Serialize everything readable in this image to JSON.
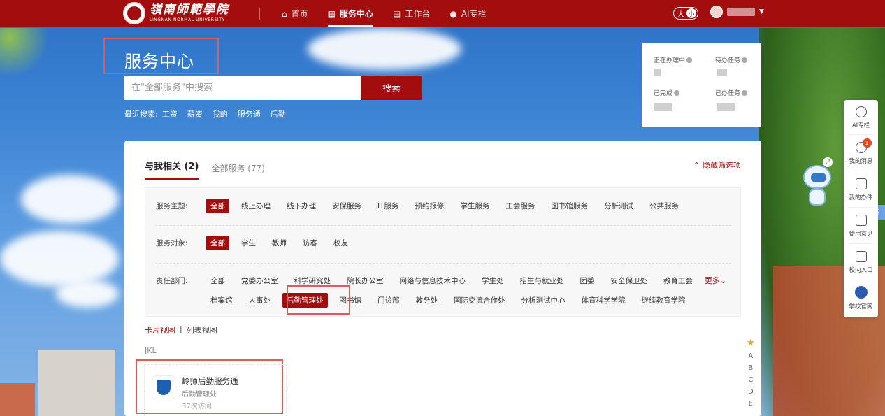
{
  "header": {
    "logo_cn": "嶺南師範學院",
    "logo_en": "LINGNAN NORMAL UNIVERSITY",
    "nav": [
      {
        "label": "首页",
        "icon": "home-icon"
      },
      {
        "label": "服务中心",
        "icon": "service-icon",
        "active": true
      },
      {
        "label": "工作台",
        "icon": "desk-icon"
      },
      {
        "label": "AI专栏",
        "icon": "ai-icon"
      }
    ],
    "font_toggle_large": "大",
    "font_toggle_small": "小"
  },
  "hero": {
    "title": "服务中心",
    "search_placeholder": "在\"全部服务\"中搜索",
    "search_button": "搜索",
    "recent_label": "最近搜索:",
    "recent_terms": [
      "工资",
      "薪资",
      "我的",
      "服务通",
      "后勤"
    ]
  },
  "stats": {
    "in_progress": "正在办理中",
    "todo": "待办任务",
    "done": "已完成",
    "handled": "已办任务"
  },
  "tabs": {
    "mine": "与我相关 (2)",
    "all": "全部服务 (77)",
    "hide_filter": "隐藏筛选项"
  },
  "filters": {
    "theme_label": "服务主题:",
    "theme_chips": [
      "全部",
      "线上办理",
      "线下办理",
      "安保服务",
      "IT服务",
      "预约报修",
      "学生服务",
      "工会服务",
      "图书馆服务",
      "分析测试",
      "公共服务"
    ],
    "target_label": "服务对象:",
    "target_chips": [
      "全部",
      "学生",
      "教师",
      "访客",
      "校友"
    ],
    "dept_label": "责任部门:",
    "dept_chips_row1": [
      "全部",
      "党委办公室",
      "科学研究处",
      "院长办公室",
      "网络与信息技术中心",
      "学生处",
      "招生与就业处",
      "团委",
      "安全保卫处",
      "教育工会"
    ],
    "dept_chips_row2": [
      "档案馆",
      "人事处",
      "后勤管理处",
      "图书馆",
      "门诊部",
      "教务处",
      "国际交流合作处",
      "分析测试中心",
      "体育科学学院",
      "继续教育学院"
    ],
    "more": "更多"
  },
  "view": {
    "card": "卡片视图",
    "sep": "|",
    "list": "列表视图"
  },
  "group_letter": "JKL",
  "service": {
    "name": "岭师后勤服务通",
    "dept": "后勤管理处",
    "visits": "37次访问"
  },
  "alpha_index": [
    "A",
    "B",
    "C",
    "D",
    "E"
  ],
  "float_bar": [
    {
      "label": "AI专栏",
      "icon": "ai-assistant-icon"
    },
    {
      "label": "我的消息",
      "icon": "bell-icon",
      "badge": "1"
    },
    {
      "label": "我的办件",
      "icon": "document-icon"
    },
    {
      "label": "使用意见",
      "icon": "feedback-icon"
    },
    {
      "label": "校内入口",
      "icon": "layers-icon"
    },
    {
      "label": "学校官网",
      "icon": "school-logo-icon"
    }
  ],
  "translate": "译",
  "colors": {
    "brand": "#a30d0d",
    "highlight_box": "#e05a5a",
    "badge": "#e8431c"
  }
}
